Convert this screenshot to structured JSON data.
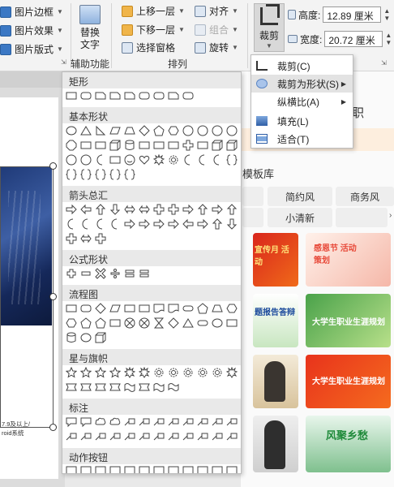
{
  "ribbon": {
    "picture_border": "图片边框",
    "picture_effects": "图片效果",
    "picture_layout": "图片版式",
    "alt_text_line1": "替换",
    "alt_text_line2": "文字",
    "accessibility_group": "辅助功能",
    "bring_forward": "上移一层",
    "send_backward": "下移一层",
    "selection_pane": "选择窗格",
    "align": "对齐",
    "group": "组合",
    "rotate": "旋转",
    "arrange_group": "排列",
    "crop": "裁剪",
    "height_label": "高度:",
    "height_value": "12.89 厘米",
    "width_label": "宽度:",
    "width_value": "20.72 厘米"
  },
  "crop_menu": {
    "items": [
      {
        "label": "裁剪(C)"
      },
      {
        "label": "裁剪为形状(S)"
      },
      {
        "label": "纵横比(A)"
      },
      {
        "label": "填充(L)"
      },
      {
        "label": "适合(T)"
      }
    ]
  },
  "shapes": {
    "sections": [
      {
        "title": "矩形"
      },
      {
        "title": "基本形状"
      },
      {
        "title": "箭头总汇"
      },
      {
        "title": "公式形状"
      },
      {
        "title": "流程图"
      },
      {
        "title": "星与旗帜"
      },
      {
        "title": "标注"
      },
      {
        "title": "动作按钮"
      }
    ]
  },
  "document": {
    "text_line1": "7.9及以上/",
    "text_line2": "roid系统"
  },
  "right_pane": {
    "tab_fragment": "职",
    "title_fragment": "模板库",
    "tags": [
      "简约风",
      "商务风",
      "小清新"
    ],
    "cards": [
      {
        "text": "宣传月 活动"
      },
      {
        "text": "感恩节 活动策划"
      },
      {
        "text": "题报告答辩"
      },
      {
        "text": "大学生职业生涯规划"
      },
      {
        "text": "大学生职业生涯规划"
      },
      {
        "text": "风聚乡愁"
      }
    ]
  },
  "colors": {
    "accent": "#3b78c4",
    "menu_highlight": "#e3e3e3"
  }
}
